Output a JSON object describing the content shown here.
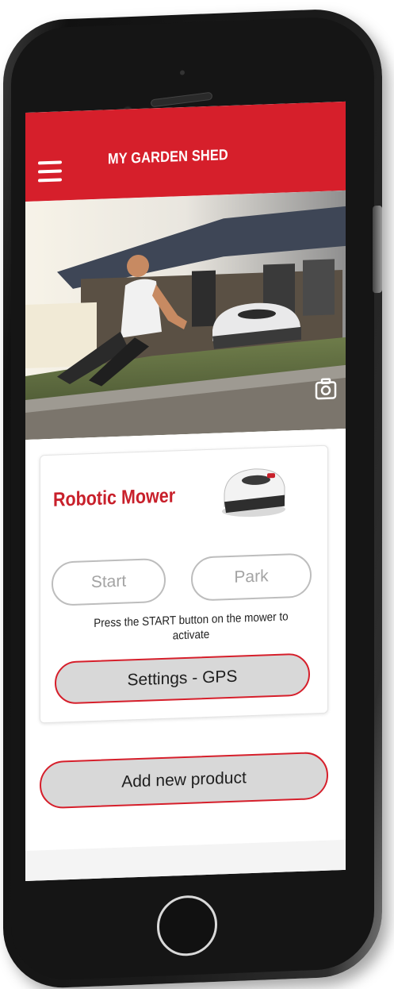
{
  "header": {
    "title": "MY GARDEN SHED",
    "menu_icon": "hamburger-menu-icon",
    "accent_color": "#d61f2b"
  },
  "hero": {
    "camera_icon": "camera-icon"
  },
  "product_card": {
    "name": "Robotic Mower",
    "name_color": "#c8202b",
    "start_label": "Start",
    "park_label": "Park",
    "hint": "Press the START button on the mower to activate",
    "settings_label": "Settings - GPS"
  },
  "footer": {
    "add_product_label": "Add new product"
  }
}
